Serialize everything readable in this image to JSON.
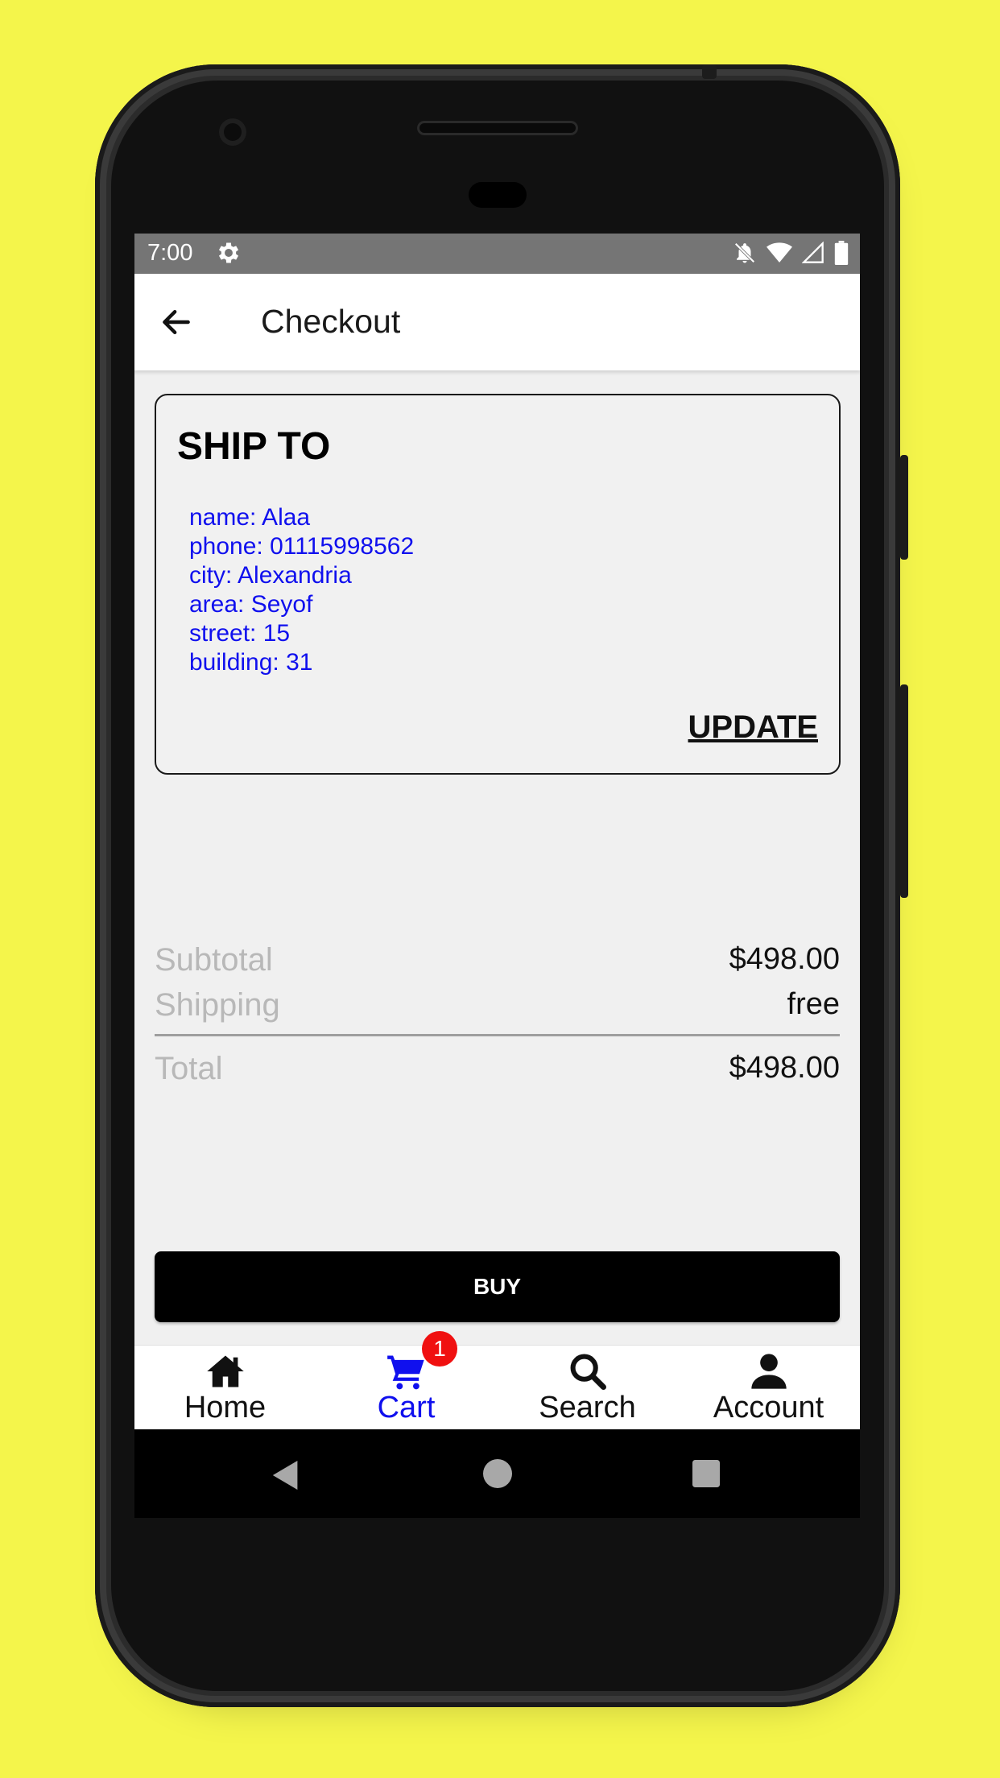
{
  "status_bar": {
    "time": "7:00"
  },
  "app_bar": {
    "title": "Checkout"
  },
  "ship_to": {
    "heading": "SHIP TO",
    "lines": [
      "name: Alaa",
      "phone: 01115998562",
      "city: Alexandria",
      "area: Seyof",
      "street: 15",
      "building: 31"
    ],
    "update_label": "UPDATE"
  },
  "summary": {
    "subtotal_label": "Subtotal",
    "subtotal_value": "$498.00",
    "shipping_label": "Shipping",
    "shipping_value": "free",
    "total_label": "Total",
    "total_value": "$498.00"
  },
  "buy_label": "BUY",
  "bottom_nav": {
    "items": [
      {
        "label": "Home",
        "icon": "home-icon"
      },
      {
        "label": "Cart",
        "icon": "cart-icon",
        "badge": "1",
        "active": true
      },
      {
        "label": "Search",
        "icon": "search-icon"
      },
      {
        "label": "Account",
        "icon": "account-icon"
      }
    ]
  },
  "colors": {
    "background": "#f4f54b",
    "accent": "#1010ee",
    "badge": "#f01010",
    "button": "#000000"
  }
}
